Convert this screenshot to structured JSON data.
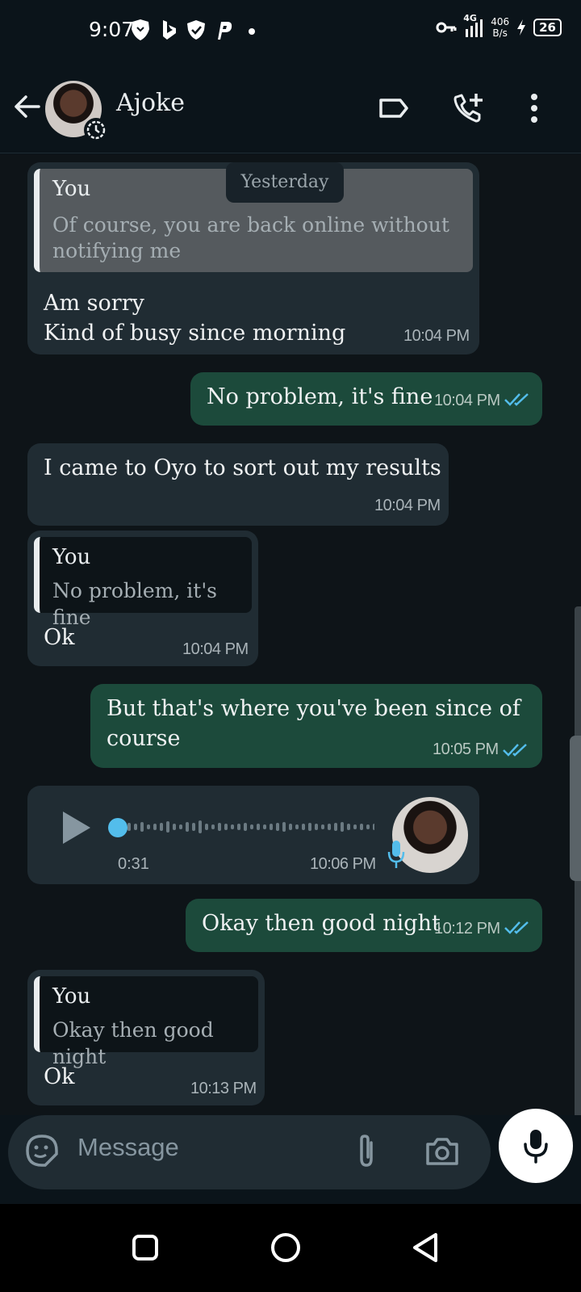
{
  "status_bar": {
    "time": "9:07",
    "network": "4G",
    "speed_value": "406",
    "speed_unit": "B/s",
    "battery": "26",
    "icons": [
      "brave-icon",
      "bing-icon",
      "shield-icon",
      "parking-icon",
      "dot-icon",
      "key-icon",
      "signal-icon",
      "charging-icon"
    ]
  },
  "header": {
    "contact_name": "Ajoke",
    "icons": [
      "back-arrow-icon",
      "label-icon",
      "add-call-icon",
      "more-vert-icon"
    ]
  },
  "chat": {
    "date_chip": "Yesterday",
    "messages": [
      {
        "dir": "in",
        "quote_author": "You",
        "quote_text_1": "Of course, you are back online without",
        "quote_text_2": "notifying me",
        "text_1": "Am sorry",
        "text_2": "Kind of busy since morning",
        "time": "10:04 PM"
      },
      {
        "dir": "out",
        "text_1": "No problem, it's fine",
        "time": "10:04 PM",
        "status": "read"
      },
      {
        "dir": "in",
        "text_1": "I came to Oyo to sort out my results",
        "time": "10:04 PM"
      },
      {
        "dir": "in",
        "quote_author": "You",
        "quote_text_1": "No problem, it's fine",
        "text_1": "Ok",
        "time": "10:04 PM"
      },
      {
        "dir": "out",
        "text_1": "But that's where you've been since of",
        "text_2": "course",
        "time": "10:05 PM",
        "status": "read"
      },
      {
        "dir": "in",
        "type": "voice",
        "duration": "0:31",
        "time": "10:06 PM",
        "progress": 0
      },
      {
        "dir": "out",
        "text_1": "Okay then good night",
        "time": "10:12 PM",
        "status": "read"
      },
      {
        "dir": "in",
        "quote_author": "You",
        "quote_text_1": "Okay then good night",
        "text_1": "Ok",
        "time": "10:13 PM"
      }
    ]
  },
  "input": {
    "placeholder": "Message",
    "icons": [
      "sticker-icon",
      "attach-icon",
      "camera-icon",
      "mic-icon"
    ]
  },
  "nav": {
    "icons": [
      "recents-icon",
      "home-icon",
      "back-icon"
    ]
  },
  "colors": {
    "background": "#0b141a",
    "incoming_bubble": "#202c33",
    "outgoing_bubble": "#1c4a3b",
    "read_ticks": "#53bdeb"
  }
}
